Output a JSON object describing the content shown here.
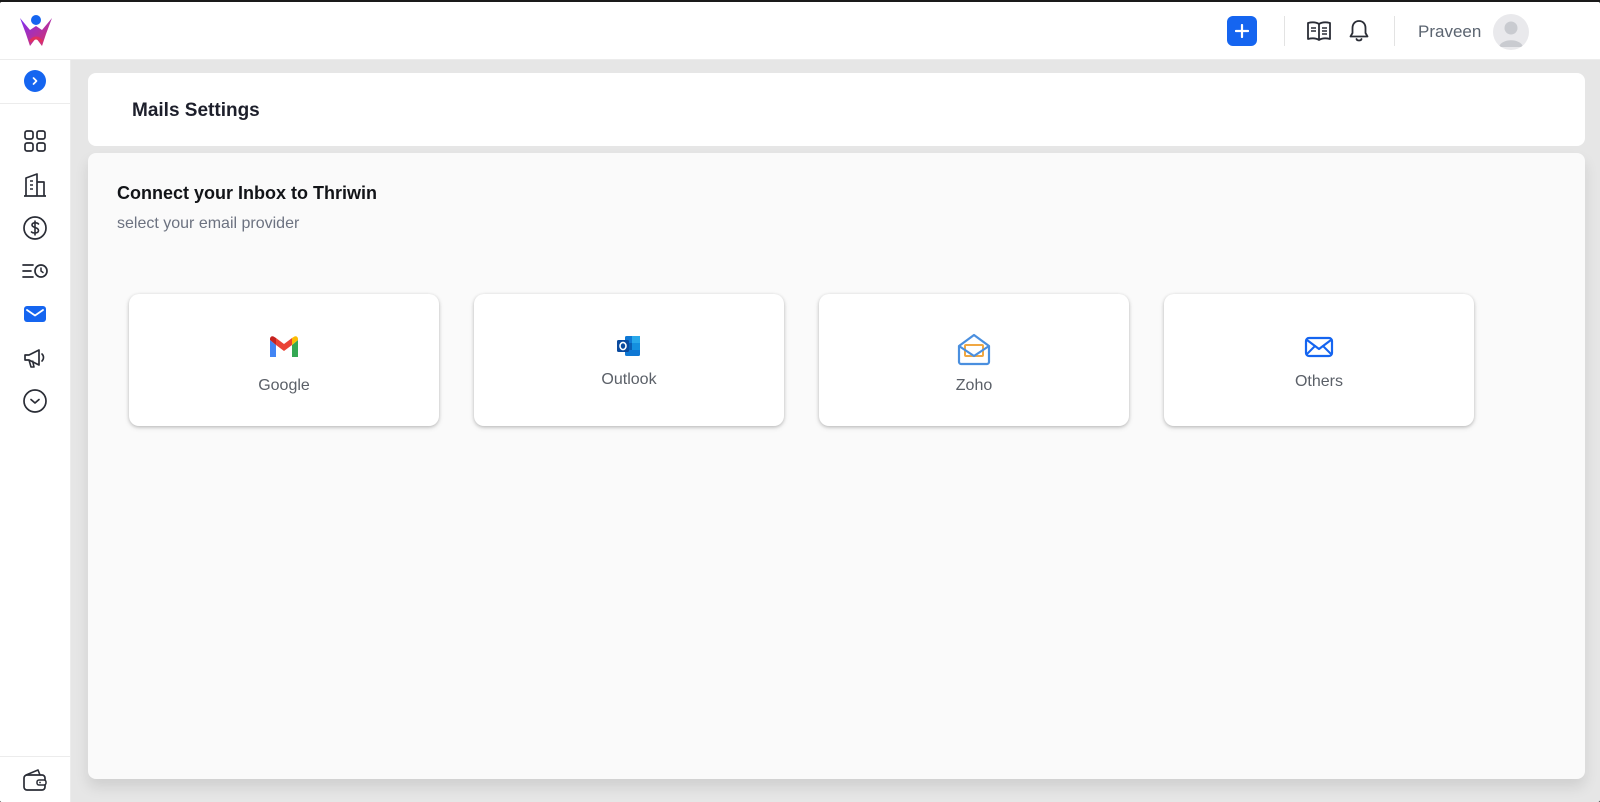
{
  "app": {
    "brand_color": "#1565f0"
  },
  "topbar": {
    "logo": "thriwin-logo",
    "add_icon": "plus-icon",
    "guide_icon": "book-icon",
    "notification_icon": "bell-icon",
    "username": "Praveen",
    "avatar_icon": "user-avatar-icon"
  },
  "sidebar": {
    "expand_icon": "chevron-right-icon",
    "items": [
      {
        "icon": "grid-icon",
        "active": false
      },
      {
        "icon": "building-icon",
        "active": false
      },
      {
        "icon": "dollar-icon",
        "active": false
      },
      {
        "icon": "list-clock-icon",
        "active": false
      },
      {
        "icon": "mail-icon",
        "active": true
      },
      {
        "icon": "megaphone-icon",
        "active": false
      },
      {
        "icon": "chevron-down-circle-icon",
        "active": false
      }
    ],
    "bottom_icon": "wallet-icon"
  },
  "header": {
    "title": "Mails Settings"
  },
  "main": {
    "title": "Connect your Inbox to Thriwin",
    "subtitle": "select your email provider",
    "providers": [
      {
        "label": "Google",
        "icon": "gmail-icon"
      },
      {
        "label": "Outlook",
        "icon": "outlook-icon"
      },
      {
        "label": "Zoho",
        "icon": "zoho-mail-icon"
      },
      {
        "label": "Others",
        "icon": "envelope-icon"
      }
    ]
  }
}
